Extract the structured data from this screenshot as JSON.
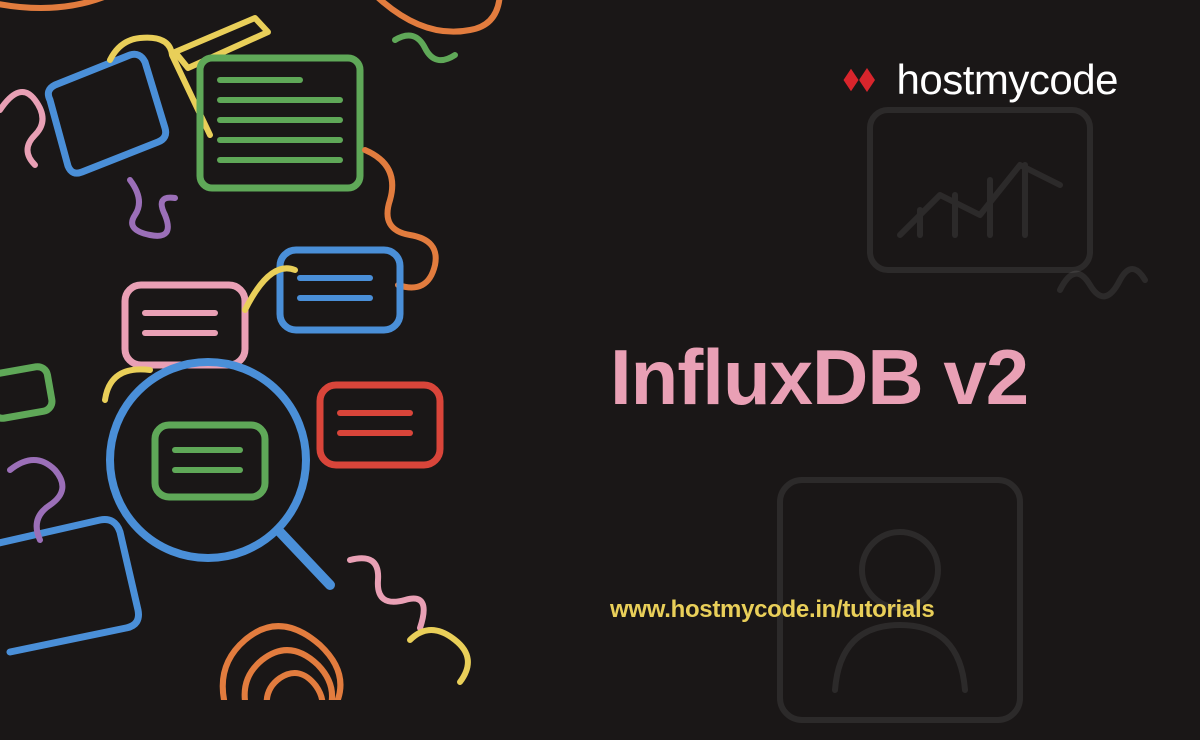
{
  "logo": {
    "brand_left": "host",
    "brand_mid": "my",
    "brand_right": "code"
  },
  "title": "InfluxDB v2",
  "url": "www.hostmycode.in/tutorials",
  "colors": {
    "bg": "#1a1717",
    "title": "#e9a0b5",
    "url": "#e9cf59",
    "logo_icon": "#d9252c",
    "white": "#ffffff"
  }
}
